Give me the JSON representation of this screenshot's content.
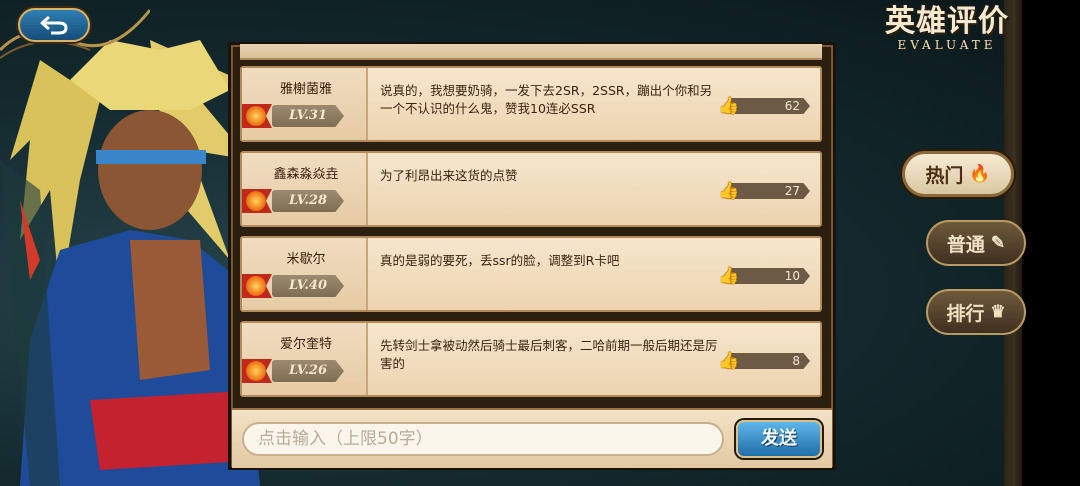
{
  "header": {
    "title_cn": "英雄评价",
    "title_en": "EVALUATE",
    "back_icon": "back-arrow-icon"
  },
  "side_tabs": [
    {
      "label": "热门",
      "icon": "flame-icon",
      "active": true
    },
    {
      "label": "普通",
      "icon": "pencil-icon",
      "active": false
    },
    {
      "label": "排行",
      "icon": "crown-icon",
      "active": false
    }
  ],
  "comments": [
    {
      "user": "雅榭菌雅",
      "level": "LV.31",
      "text": "说真的，我想要奶骑，一发下去2SR，2SSR，蹦出个你和另一个不认识的什么鬼，赞我10连必SSR",
      "likes": "62"
    },
    {
      "user": "鑫森淼焱垚",
      "level": "LV.28",
      "text": "为了利昂出来这货的点赞",
      "likes": "27"
    },
    {
      "user": "米歇尔",
      "level": "LV.40",
      "text": "真的是弱的要死，丢ssr的脸，调整到R卡吧",
      "likes": "10"
    },
    {
      "user": "爱尔奎特",
      "level": "LV.26",
      "text": "先转剑士拿被动然后骑士最后刺客，二哈前期一般后期还是厉害的",
      "likes": "8"
    }
  ],
  "input": {
    "placeholder": "点击输入（上限50字）",
    "send_label": "发送"
  },
  "colors": {
    "card_bg": "#f4e2c4",
    "accent_blue": "#2f7fb3",
    "level_red": "#c0281c",
    "like_gold": "#f2c22a"
  }
}
